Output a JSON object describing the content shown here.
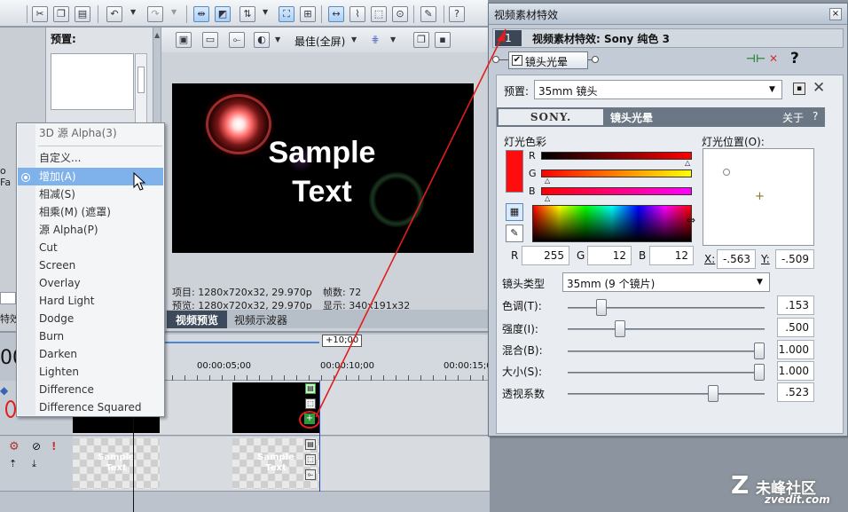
{
  "toolbar": {
    "icons": [
      "cut-icon",
      "copy-icon",
      "paste-icon",
      "undo-icon",
      "redo-icon",
      "snap-icon",
      "marker-icon",
      "ripple-icon",
      "lock-envelope-icon",
      "auto-crossfade-icon",
      "normal-edit-icon",
      "envelope-edit-icon",
      "selection-edit-icon",
      "zoom-edit-icon",
      "render-icon",
      "whats-this-icon"
    ]
  },
  "preset_panel": {
    "label": "预置:"
  },
  "preview": {
    "toolbar": {
      "quality": "最佳(全屏)"
    },
    "sample_text": "Sample\nText",
    "info": {
      "project": "项目: 1280x720x32, 29.970p",
      "frame": "帧数: 72",
      "preview": "预览: 1280x720x32, 29.970p",
      "display": "显示: 340x191x32"
    },
    "tabs": [
      "视频预览",
      "视频示波器"
    ]
  },
  "composite_menu": {
    "items": [
      "3D 源 Alpha(3)",
      "自定义...",
      "增加(A)",
      "相减(S)",
      "相乘(M) (遮罩)",
      "源 Alpha(P)",
      "Cut",
      "Screen",
      "Overlay",
      "Hard Light",
      "Dodge",
      "Burn",
      "Darken",
      "Lighten",
      "Difference",
      "Difference Squared"
    ],
    "selected": "增加(A)"
  },
  "timeline": {
    "time_display": "00",
    "ruler_marks": [
      "00:00:05;00",
      "00:00:10;00",
      "00:00:15;0"
    ],
    "region_length": "+10;00",
    "left_label": "o Fa",
    "left_label_2": "特效",
    "clip_text": "Sample\nText"
  },
  "fx_window": {
    "title": "视频素材特效",
    "chain_index": "1",
    "chain_title": "视频素材特效: Sony 纯色 3",
    "plugin_checkbox_label": "镜头光晕",
    "plugin_checked": true,
    "preset": {
      "label": "预置:",
      "value": "35mm 镜头"
    },
    "header": {
      "brand": "SONY.",
      "plugin": "镜头光晕",
      "about": "关于",
      "help": "?"
    },
    "color": {
      "label": "灯光色彩",
      "hex": "#ff0c0c",
      "channels": [
        "R",
        "G",
        "B"
      ],
      "r": "255",
      "g": "12",
      "b": "12"
    },
    "position": {
      "label": "灯光位置(O):",
      "x_label": "X:",
      "x": "-.563",
      "y_label": "Y:",
      "y": "-.509"
    },
    "lens": {
      "label": "镜头类型",
      "value": "35mm (9 个镜片)"
    },
    "sliders": [
      {
        "label": "色调(T):",
        "value": ".153",
        "fraction": 0.153
      },
      {
        "label": "强度(I):",
        "value": ".500",
        "fraction": 0.25
      },
      {
        "label": "混合(B):",
        "value": "1.000",
        "fraction": 1.0
      },
      {
        "label": "大小(S):",
        "value": "1.000",
        "fraction": 1.0
      },
      {
        "label": "透视系数",
        "value": ".523",
        "fraction": 0.75
      }
    ]
  },
  "watermark": {
    "line1": "未峰社区",
    "line2": "zvedit.com"
  },
  "colors": {
    "annotation_red": "#e21d1d",
    "selection_blue": "#7fb1ea",
    "title_bar": "#b9c6d6"
  }
}
